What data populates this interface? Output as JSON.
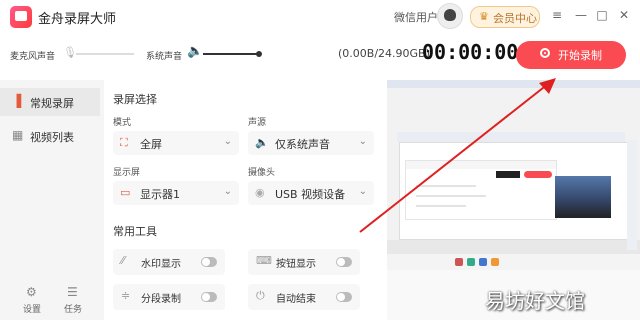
{
  "app": {
    "title": "金舟录屏大师",
    "user_label": "微信用户",
    "vip_label": "会员中心",
    "window_controls": {
      "menu": "≡",
      "minimize": "—",
      "maximize": "□",
      "close": "✕"
    }
  },
  "controls": {
    "mic_label": "麦克风声音",
    "mic_volume": 0.0,
    "system_label": "系统声音",
    "system_volume": 1.0,
    "storage": "(0.00B/24.90GB)",
    "timer": "00:00:00",
    "record_label": "开始录制"
  },
  "sidebar": {
    "items": [
      {
        "label": "常规录屏",
        "icon": "screen-record-icon",
        "active": true
      },
      {
        "label": "视频列表",
        "icon": "video-list-icon",
        "active": false
      }
    ],
    "footer": [
      {
        "label": "设置",
        "icon": "settings-icon"
      },
      {
        "label": "任务",
        "icon": "task-icon"
      }
    ]
  },
  "record_select": {
    "title": "录屏选择",
    "fields": [
      {
        "label": "模式",
        "value": "全屏",
        "icon": "fullscreen-icon"
      },
      {
        "label": "声源",
        "value": "仅系统声音",
        "icon": "speaker-icon"
      },
      {
        "label": "显示屏",
        "value": "显示器1",
        "icon": "monitor-icon"
      },
      {
        "label": "摄像头",
        "value": "USB 视频设备",
        "icon": "camera-icon"
      }
    ]
  },
  "tools": {
    "title": "常用工具",
    "items": [
      {
        "label": "水印显示",
        "icon": "watermark-icon",
        "enabled": false
      },
      {
        "label": "按钮显示",
        "icon": "button-icon",
        "enabled": false
      },
      {
        "label": "分段录制",
        "icon": "segment-icon",
        "enabled": false
      },
      {
        "label": "自动结束",
        "icon": "power-icon",
        "enabled": false
      }
    ]
  },
  "watermark_text": "易坊好文馆",
  "colors": {
    "accent": "#fa4b52",
    "arrow": "#e02020"
  }
}
